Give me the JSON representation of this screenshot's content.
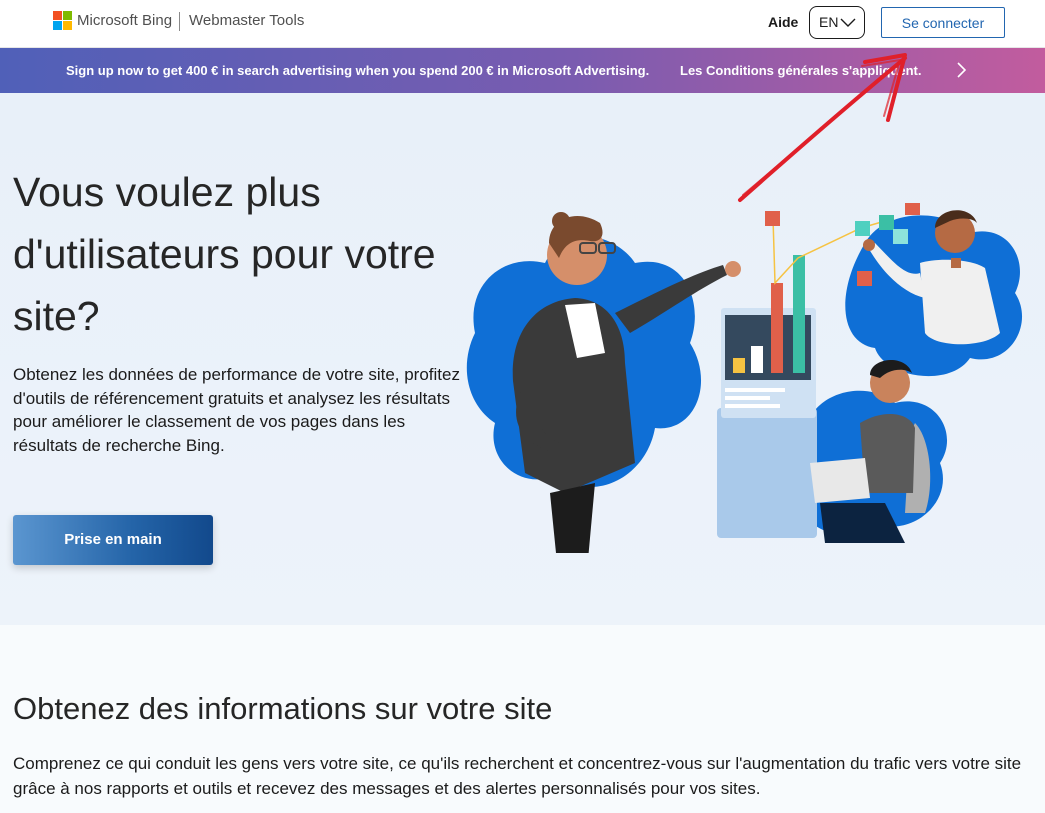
{
  "header": {
    "brand": "Microsoft Bing",
    "product": "Webmaster Tools",
    "help_label": "Aide",
    "language": "EN",
    "signin_label": "Se connecter"
  },
  "promo": {
    "text": "Sign up now to get 400 € in search advertising when you spend 200 € in Microsoft Advertising.",
    "terms_link": "Les Conditions générales s'appliquent."
  },
  "hero": {
    "title": "Vous voulez plus d'utilisateurs pour votre site?",
    "description": "Obtenez les données de performance de votre site, profitez d'outils de référencement gratuits et analysez les résultats pour améliorer le classement de vos pages dans les résultats de recherche Bing.",
    "cta_label": "Prise en main"
  },
  "info": {
    "title": "Obtenez des informations sur votre site",
    "description": "Comprenez ce qui conduit les gens vers votre site, ce qu'ils recherchent et concentrez-vous sur l'augmentation du trafic vers votre site grâce à nos rapports et outils et recevez des messages et des alertes personnalisés pour vos sites."
  },
  "icons": {
    "logo": "microsoft-logo-icon",
    "language_dropdown": "chevron-down-icon",
    "promo_next": "chevron-right-icon",
    "annotation": "red-arrow-annotation"
  },
  "colors": {
    "accent": "#2266b0",
    "promo_start": "#5060b8",
    "promo_end": "#c25c9e",
    "hero_bg": "#e8f0f9",
    "annotation": "#e0202a"
  }
}
